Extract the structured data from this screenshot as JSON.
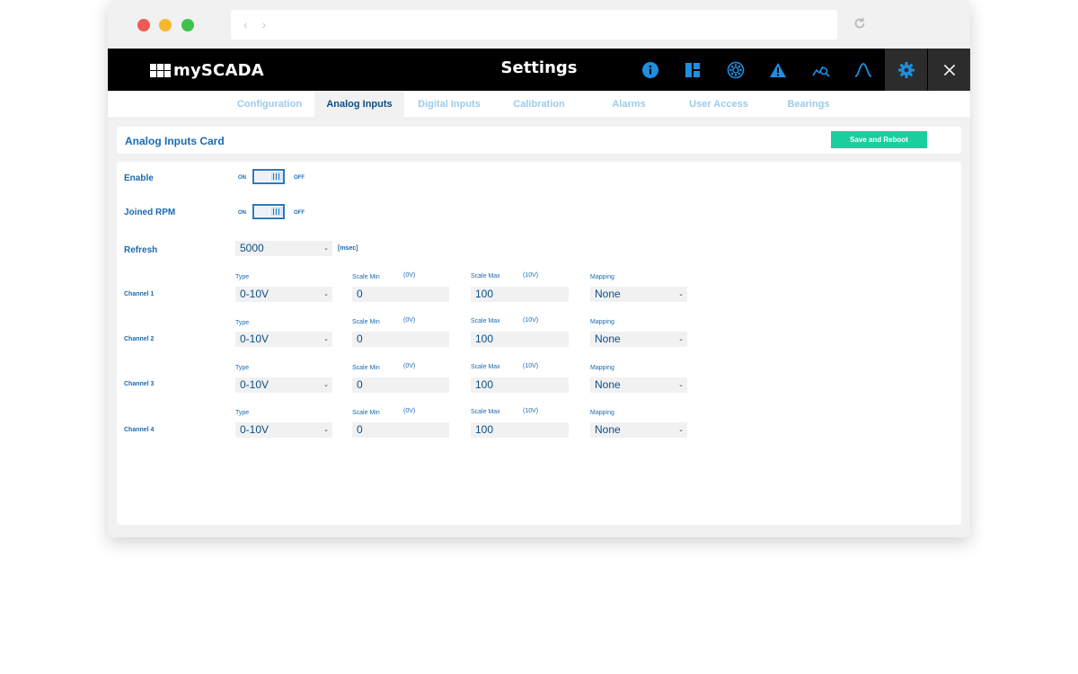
{
  "app": {
    "logo_text": "mySCADA",
    "title": "Settings"
  },
  "header_icons": [
    "info-icon",
    "dashboard-icon",
    "bearing-icon",
    "alarm-icon",
    "trend-search-icon",
    "peak-icon",
    "gear-icon",
    "close-icon"
  ],
  "tabs": [
    {
      "label": "Configuration"
    },
    {
      "label": "Analog Inputs"
    },
    {
      "label": "Digital Inputs"
    },
    {
      "label": "Calibration"
    },
    {
      "label": "Alarms"
    },
    {
      "label": "User Access"
    },
    {
      "label": "Bearings"
    }
  ],
  "active_tab": "Analog Inputs",
  "card": {
    "title": "Analog Inputs Card",
    "save_label": "Save and Reboot"
  },
  "settings": {
    "enable": {
      "label": "Enable",
      "on": "ON",
      "off": "OFF"
    },
    "joined_rpm": {
      "label": "Joined RPM",
      "on": "ON",
      "off": "OFF"
    },
    "refresh": {
      "label": "Refresh",
      "value": "5000",
      "unit": "[msec]"
    }
  },
  "channel_headers": {
    "type": "Type",
    "scale_min": "Scale Min",
    "scale_min_unit": "(0V)",
    "scale_max": "Scale Max",
    "scale_max_unit": "(10V)",
    "mapping": "Mapping"
  },
  "channels": [
    {
      "name": "Channel 1",
      "type": "0-10V",
      "scale_min": "0",
      "scale_max": "100",
      "mapping": "None"
    },
    {
      "name": "Channel 2",
      "type": "0-10V",
      "scale_min": "0",
      "scale_max": "100",
      "mapping": "None"
    },
    {
      "name": "Channel 3",
      "type": "0-10V",
      "scale_min": "0",
      "scale_max": "100",
      "mapping": "None"
    },
    {
      "name": "Channel 4",
      "type": "0-10V",
      "scale_min": "0",
      "scale_max": "100",
      "mapping": "None"
    }
  ],
  "colors": {
    "accent": "#1a6ab2",
    "save_button": "#1bce9e",
    "header_bg": "#000000",
    "icon_blue": "#1f8fe0"
  }
}
